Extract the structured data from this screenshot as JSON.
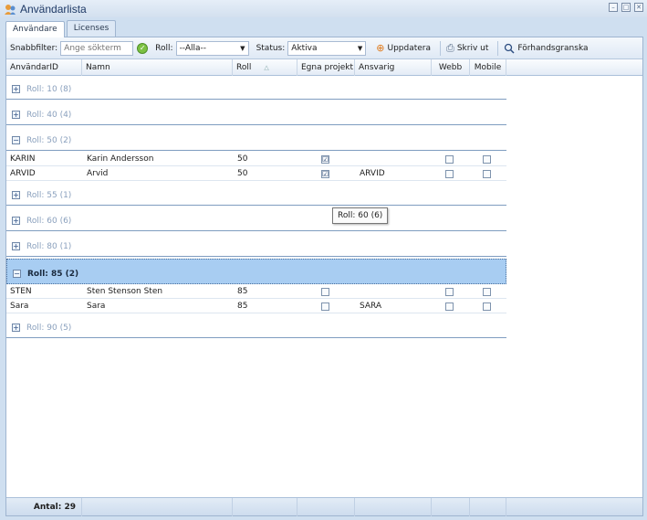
{
  "window": {
    "title": "Användarlista",
    "minimize": "–",
    "maximize": "□",
    "close": "✕"
  },
  "tabs": [
    {
      "label": "Användare"
    },
    {
      "label": "Licenses"
    }
  ],
  "toolbar": {
    "quickfilter_label": "Snabbfilter:",
    "quickfilter_placeholder": "Ange sökterm",
    "role_label": "Roll:",
    "role_value": "--Alla--",
    "status_label": "Status:",
    "status_value": "Aktiva",
    "refresh_label": "Uppdatera",
    "print_label": "Skriv ut",
    "preview_label": "Förhandsgranska"
  },
  "columns": [
    "AnvändarID",
    "Namn",
    "Roll",
    "Egna projekt",
    "Ansvarig",
    "Webb",
    "Mobile"
  ],
  "groups": [
    {
      "label": "Roll: 10 (8)",
      "expander": "+"
    },
    {
      "label": "Roll: 40 (4)",
      "expander": "+"
    },
    {
      "label": "Roll: 50 (2)",
      "expander": "−"
    },
    {
      "label": "Roll: 55 (1)",
      "expander": "+"
    },
    {
      "label": "Roll: 60 (6)",
      "expander": "+"
    },
    {
      "label": "Roll: 80 (1)",
      "expander": "+"
    },
    {
      "label": "Roll: 85 (2)",
      "expander": "−"
    },
    {
      "label": "Roll: 90 (5)",
      "expander": "+"
    }
  ],
  "rows": [
    {
      "id": "KARIN",
      "name": "Karin Andersson",
      "role": "50",
      "own_projects": "☑",
      "responsible": "",
      "web": "",
      "mobile": ""
    },
    {
      "id": "ARVID",
      "name": "Arvid",
      "role": "50",
      "own_projects": "☑",
      "responsible": "ARVID",
      "web": "",
      "mobile": ""
    },
    {
      "id": "STEN",
      "name": "Sten Stenson Sten",
      "role": "85",
      "own_projects": "",
      "responsible": "",
      "web": "",
      "mobile": ""
    },
    {
      "id": "Sara",
      "name": "Sara",
      "role": "85",
      "own_projects": "",
      "responsible": "SARA",
      "web": "",
      "mobile": ""
    }
  ],
  "tooltip": "Roll: 60 (6)",
  "footer": {
    "count_label": "Antal: 29"
  },
  "colors": {
    "selected_group": "#a8cdf2",
    "accent": "#1f3a66"
  }
}
